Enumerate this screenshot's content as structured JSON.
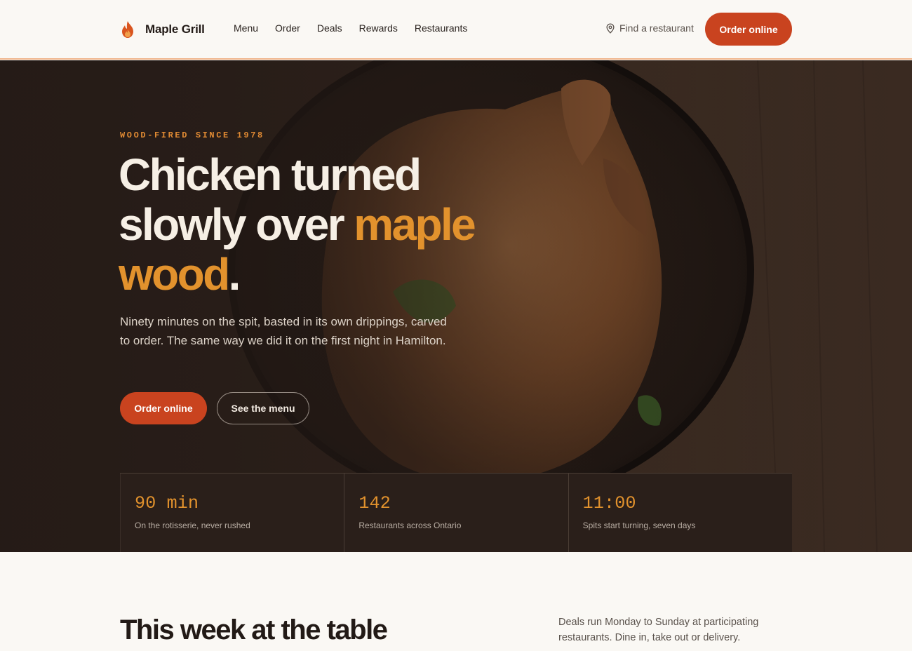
{
  "brand": {
    "name": "Maple Grill",
    "logo_icon": "flame-icon"
  },
  "nav": {
    "items": [
      {
        "label": "Menu"
      },
      {
        "label": "Order"
      },
      {
        "label": "Deals"
      },
      {
        "label": "Rewards"
      },
      {
        "label": "Restaurants"
      }
    ],
    "find_restaurant": "Find a restaurant",
    "find_icon": "map-pin-icon",
    "cta": "Order online"
  },
  "hero": {
    "eyebrow": "WOOD-FIRED SINCE 1978",
    "headline_part1": "Chicken turned slowly over ",
    "headline_accent": "maple wood",
    "headline_end": ".",
    "lede": "Ninety minutes on the spit, basted in its own drippings, carved to order. The same way we did it on the first night in Hamilton.",
    "primary_cta": "Order online",
    "secondary_cta": "See the menu"
  },
  "stats": [
    {
      "value": "90 min",
      "label": "On the rotisserie, never rushed"
    },
    {
      "value": "142",
      "label": "Restaurants across Ontario"
    },
    {
      "value": "11:00",
      "label": "Spits start turning, seven days"
    }
  ],
  "section": {
    "title": "This week at the table",
    "note": "Deals run Monday to Sunday at participating restaurants. Dine in, take out or delivery."
  },
  "colors": {
    "accent": "#c9431f",
    "highlight": "#e2922d",
    "dark": "#221a16",
    "background": "#faf8f4"
  }
}
